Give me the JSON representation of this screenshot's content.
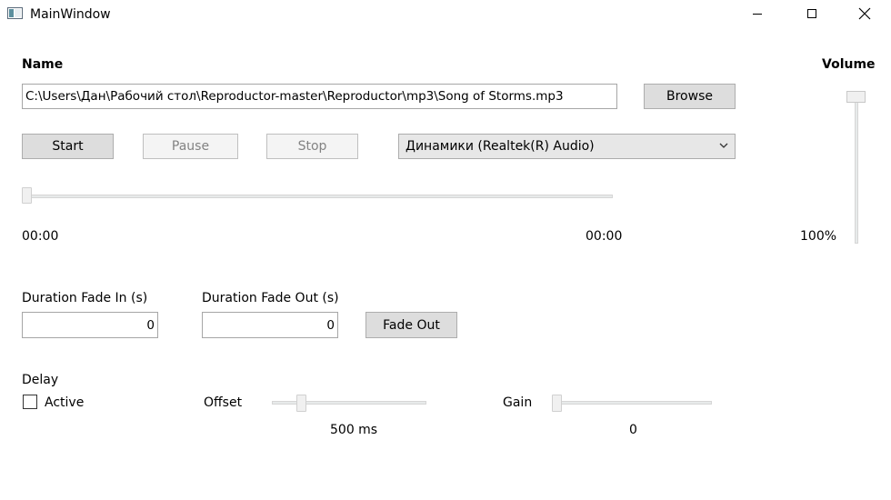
{
  "window": {
    "title": "MainWindow"
  },
  "file": {
    "name_label": "Name",
    "path": "C:\\Users\\Дан\\Рабочий стол\\Reproductor-master\\Reproductor\\mp3\\Song of Storms.mp3",
    "browse_label": "Browse"
  },
  "transport": {
    "start_label": "Start",
    "pause_label": "Pause",
    "stop_label": "Stop",
    "device_selected": "Динамики (Realtek(R) Audio)"
  },
  "progress": {
    "position_fraction": 0,
    "current_time": "00:00",
    "total_time": "00:00"
  },
  "volume": {
    "label": "Volume",
    "value_fraction": 1.0,
    "value_text": "100%"
  },
  "fade": {
    "fade_in_label": "Duration Fade In (s)",
    "fade_in_value": "0",
    "fade_out_label": "Duration Fade Out (s)",
    "fade_out_value": "0",
    "fade_out_button": "Fade Out"
  },
  "delay": {
    "label": "Delay",
    "active_label": "Active",
    "active_checked": false,
    "offset_label": "Offset",
    "offset_fraction": 0.17,
    "offset_value": "500 ms",
    "gain_label": "Gain",
    "gain_fraction": 0,
    "gain_value": "0"
  }
}
